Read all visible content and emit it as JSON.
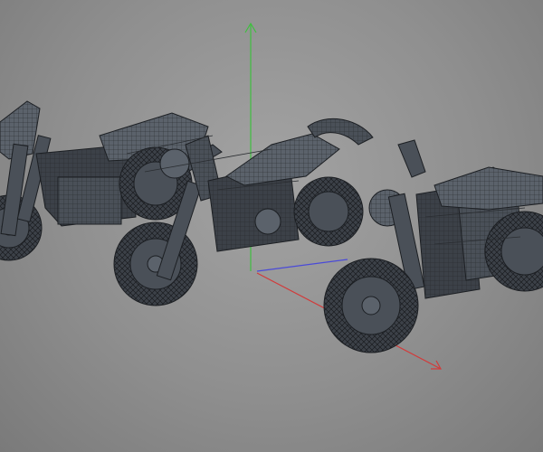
{
  "viewport": {
    "background": "#9a9a9a",
    "model": "lego-motorcycle-wireframe",
    "instances": 3
  },
  "gizmo": {
    "y_axis_color": "#3fbf3f",
    "x_axis_color": "#d23a3a",
    "z_axis_color": "#4a4ad8"
  },
  "icons": [
    "y-axis-icon",
    "x-axis-icon",
    "z-axis-icon"
  ]
}
